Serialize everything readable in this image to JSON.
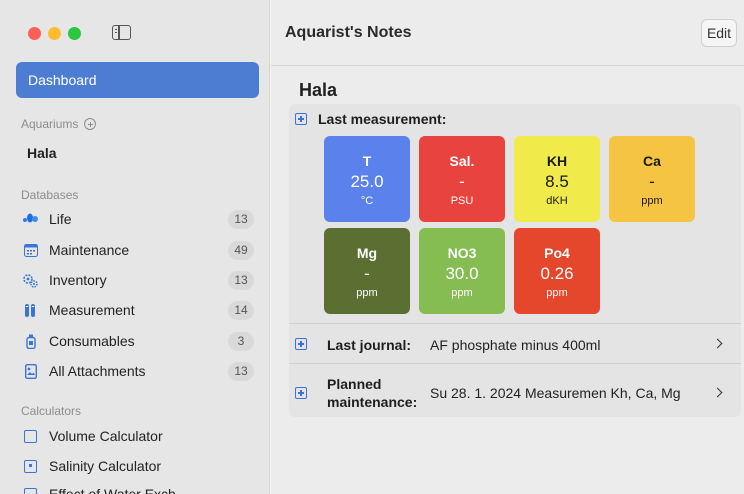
{
  "sidebar": {
    "selected": "Dashboard",
    "aquariums_heading": "Aquariums",
    "aquarium": "Hala",
    "databases_heading": "Databases",
    "databases": [
      {
        "label": "Life",
        "count": "13",
        "icon": "fish-icon"
      },
      {
        "label": "Maintenance",
        "count": "49",
        "icon": "calendar-icon"
      },
      {
        "label": "Inventory",
        "count": "13",
        "icon": "gears-icon"
      },
      {
        "label": "Measurement",
        "count": "14",
        "icon": "test-tubes-icon"
      },
      {
        "label": "Consumables",
        "count": "3",
        "icon": "bottle-icon"
      },
      {
        "label": "All Attachments",
        "count": "13",
        "icon": "attachment-icon"
      }
    ],
    "calculators_heading": "Calculators",
    "calculators": [
      {
        "label": "Volume Calculator"
      },
      {
        "label": "Salinity Calculator"
      },
      {
        "label": "Effect of Water Exch..."
      }
    ]
  },
  "header": {
    "title": "Aquarist's Notes",
    "edit_label": "Edit"
  },
  "main": {
    "title": "Hala",
    "last_measurement_label": "Last measurement:",
    "tiles": [
      {
        "name": "T",
        "value": "25.0",
        "unit": "°C",
        "color": "#5b81ec"
      },
      {
        "name": "Sal.",
        "value": "-",
        "unit": "PSU",
        "color": "#e8433e"
      },
      {
        "name": "KH",
        "value": "8.5",
        "unit": "dKH",
        "color": "#f1ea4b"
      },
      {
        "name": "Ca",
        "value": "-",
        "unit": "ppm",
        "color": "#f6c443"
      },
      {
        "name": "Mg",
        "value": "-",
        "unit": "ppm",
        "color": "#5b6f33"
      },
      {
        "name": "NO3",
        "value": "30.0",
        "unit": "ppm",
        "color": "#86bd53"
      },
      {
        "name": "Po4",
        "value": "0.26",
        "unit": "ppm",
        "color": "#e5472c"
      }
    ],
    "journal_label": "Last journal:",
    "journal_value": "AF phosphate minus 400ml",
    "maintenance_label_1": "Planned",
    "maintenance_label_2": "maintenance:",
    "maintenance_value": "Su 28. 1. 2024  Measuremen Kh, Ca, Mg"
  }
}
